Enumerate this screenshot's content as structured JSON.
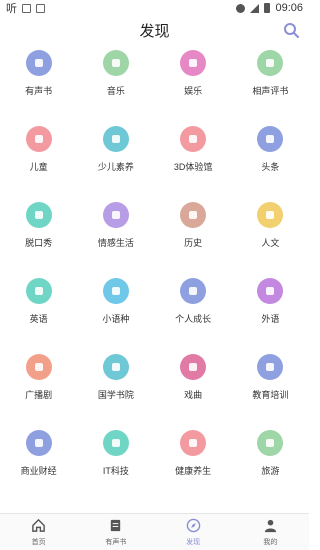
{
  "status": {
    "brand": "听",
    "time": "09:06"
  },
  "header": {
    "title": "发现"
  },
  "grid": [
    {
      "label": "有声书",
      "color": "#8ea0e0",
      "icon": "book-icon"
    },
    {
      "label": "音乐",
      "color": "#9fd6a8",
      "icon": "music-icon"
    },
    {
      "label": "娱乐",
      "color": "#e788c6",
      "icon": "smile-icon"
    },
    {
      "label": "相声评书",
      "color": "#9fd6a8",
      "icon": "fan-icon"
    },
    {
      "label": "儿童",
      "color": "#f29aa0",
      "icon": "bear-icon"
    },
    {
      "label": "少儿素养",
      "color": "#6fc8d6",
      "icon": "graduation-cap-icon"
    },
    {
      "label": "3D体验馆",
      "color": "#f29aa0",
      "icon": "cube-icon"
    },
    {
      "label": "头条",
      "color": "#8ea0e0",
      "icon": "newspaper-icon"
    },
    {
      "label": "脱口秀",
      "color": "#6fd6c6",
      "icon": "microphone-icon"
    },
    {
      "label": "情感生活",
      "color": "#b79ce6",
      "icon": "heart-icon"
    },
    {
      "label": "历史",
      "color": "#d9a898",
      "icon": "temple-icon"
    },
    {
      "label": "人文",
      "color": "#f2cf6f",
      "icon": "brush-icon"
    },
    {
      "label": "英语",
      "color": "#6fd6c6",
      "icon": "english-book-icon"
    },
    {
      "label": "小语种",
      "color": "#6fc8e8",
      "icon": "chat-icon"
    },
    {
      "label": "个人成长",
      "color": "#8ea0e0",
      "icon": "tv-icon"
    },
    {
      "label": "外语",
      "color": "#c388e0",
      "icon": "en-icon"
    },
    {
      "label": "广播剧",
      "color": "#f2a08a",
      "icon": "radio-icon"
    },
    {
      "label": "国学书院",
      "color": "#6fc8d6",
      "icon": "graduation-cap-icon"
    },
    {
      "label": "戏曲",
      "color": "#e27aa6",
      "icon": "opera-mask-icon"
    },
    {
      "label": "教育培训",
      "color": "#8ea0e0",
      "icon": "medal-icon"
    },
    {
      "label": "商业财经",
      "color": "#8ea0e0",
      "icon": "chart-icon"
    },
    {
      "label": "IT科技",
      "color": "#6fd6c6",
      "icon": "chip-icon"
    },
    {
      "label": "健康养生",
      "color": "#f29aa0",
      "icon": "cup-icon"
    },
    {
      "label": "旅游",
      "color": "#9fd6a8",
      "icon": "plane-icon"
    }
  ],
  "tabs": [
    {
      "label": "首页",
      "icon": "home-icon"
    },
    {
      "label": "有声书",
      "icon": "audiobook-icon"
    },
    {
      "label": "发现",
      "icon": "compass-icon",
      "active": true
    },
    {
      "label": "我的",
      "icon": "user-icon"
    }
  ],
  "colors": {
    "accent": "#8a8fd6"
  }
}
